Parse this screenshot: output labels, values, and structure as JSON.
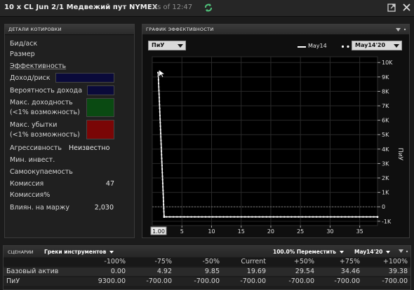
{
  "window": {
    "title": "10 x CL Jun 2/1 Медвежий пут NYMEX",
    "as_of": "as of 12:47"
  },
  "details": {
    "header": "ДЕТАЛИ КОТИРОВКИ",
    "bid_ask": "Бид/аск",
    "size": "Размер",
    "efficiency": "Эффективность",
    "profit_risk": "Доход/риск",
    "profit_prob": "Вероятность дохода",
    "max_profit_1": "Макс. доходность",
    "max_profit_2": "(<1% возможность)",
    "max_loss_1": "Макс. убытки",
    "max_loss_2": "(<1% возможность)",
    "aggressiveness": "Агрессивность",
    "aggressiveness_value": "Неизвестно",
    "min_invest": "Мин. инвест.",
    "breakeven": "Самоокупаемость",
    "commission": "Комиссия",
    "commission_value": "47",
    "commission_pct": "Комиссия%",
    "margin_impact": "Влиян. на маржу",
    "margin_impact_value": "2,030",
    "colors": {
      "profit_risk": "#0a0a3a",
      "profit_prob": "#0a0a3a",
      "max_profit": "#0a4a12",
      "max_loss": "#7a0606"
    }
  },
  "chart_panel": {
    "header": "ГРАФИК ЭФФЕКТИВНОСТИ",
    "metric_dropdown": "ПиУ",
    "legend_solid": "May14",
    "legend_dotted_dropdown": "May14'20",
    "y_axis_title": "ПиУ",
    "x_start_label": "1.00"
  },
  "chart_data": {
    "type": "line",
    "title": "",
    "xlabel": "",
    "ylabel": "ПиУ",
    "xlim": [
      0,
      38
    ],
    "ylim": [
      -1300,
      10400
    ],
    "x_ticks": [
      5,
      10,
      15,
      20,
      25,
      30,
      35
    ],
    "y_ticks": [
      {
        "value": 10000,
        "label": "10K"
      },
      {
        "value": 9000,
        "label": "9K"
      },
      {
        "value": 8000,
        "label": "8K"
      },
      {
        "value": 7000,
        "label": "7K"
      },
      {
        "value": 6000,
        "label": "6K"
      },
      {
        "value": 5000,
        "label": "5K"
      },
      {
        "value": 4000,
        "label": "4K"
      },
      {
        "value": 3000,
        "label": "3K"
      },
      {
        "value": 2000,
        "label": "2K"
      },
      {
        "value": 1000,
        "label": "1K"
      },
      {
        "value": 0,
        "label": "0"
      },
      {
        "value": -1000,
        "label": "-1K"
      }
    ],
    "zero_line": 0,
    "grid": true,
    "series": [
      {
        "name": "May14",
        "style": "solid",
        "x": [
          1,
          2,
          38
        ],
        "y": [
          9300,
          -700,
          -700
        ]
      },
      {
        "name": "May14'20",
        "style": "dotted",
        "x": [
          1,
          2,
          38
        ],
        "y": [
          9300,
          -700,
          -700
        ]
      }
    ]
  },
  "scenarios": {
    "header": "СЦЕНАРИИ",
    "greeks_dropdown": "Греки инструментов",
    "shift_dropdown": "100.0% Переместить",
    "date_dropdown": "May14'20",
    "columns": [
      "-100%",
      "-75%",
      "-50%",
      "Current",
      "+50%",
      "+75%",
      "+100%"
    ],
    "rows": [
      {
        "label": "Базовый актив",
        "values": [
          "0.00",
          "4.92",
          "9.85",
          "19.69",
          "29.54",
          "34.46",
          "39.38"
        ]
      },
      {
        "label": "ПиУ",
        "values": [
          "9300.00",
          "-700.00",
          "-700.00",
          "-700.00",
          "-700.00",
          "-700.00",
          "-700.00"
        ]
      }
    ]
  }
}
